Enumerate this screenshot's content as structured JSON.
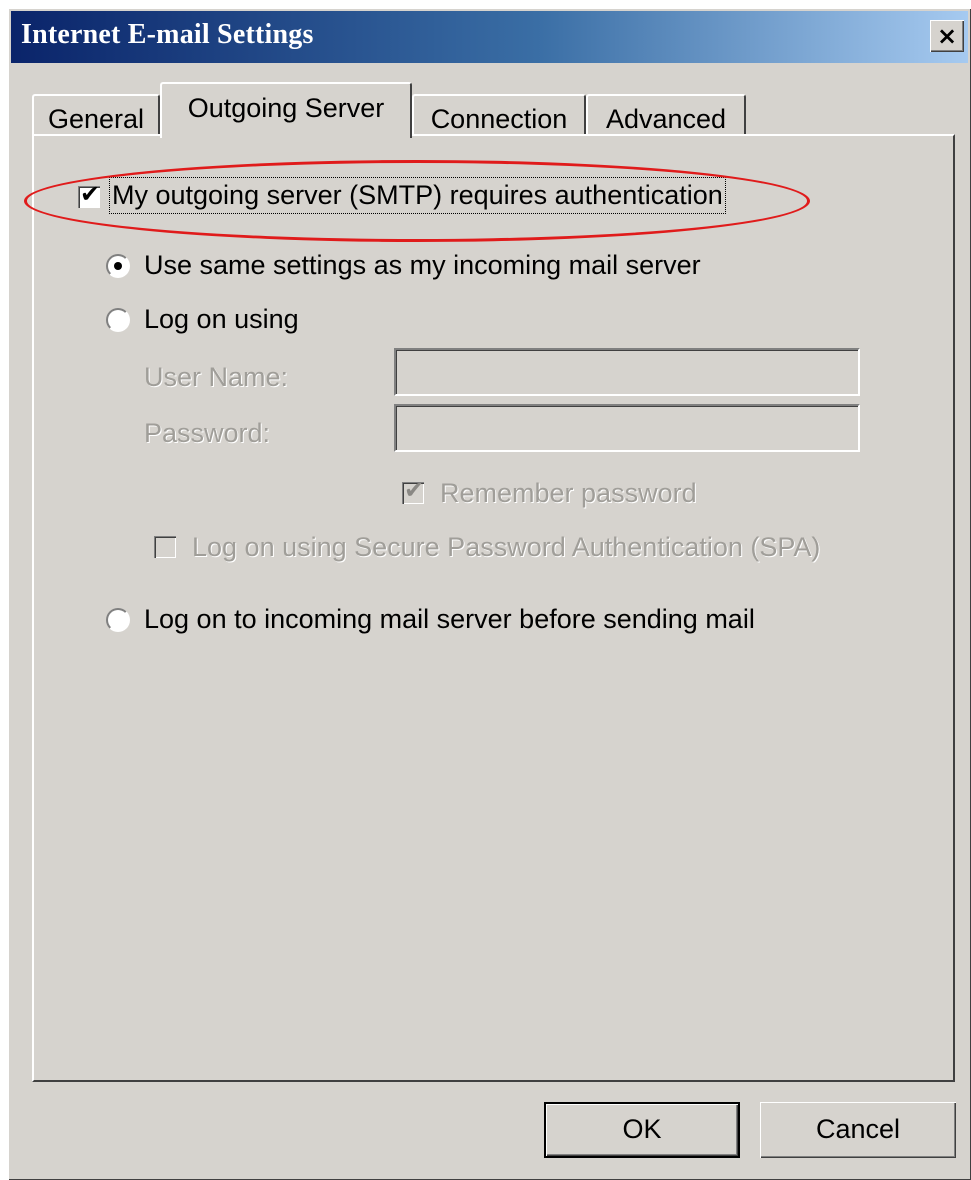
{
  "window": {
    "title": "Internet E-mail Settings",
    "close_glyph": "×"
  },
  "tabs": [
    {
      "label": "General",
      "active": false
    },
    {
      "label": "Outgoing Server",
      "active": true
    },
    {
      "label": "Connection",
      "active": false
    },
    {
      "label": "Advanced",
      "active": false
    }
  ],
  "outgoing": {
    "smtp_auth_label": "My outgoing server (SMTP) requires authentication",
    "smtp_auth_checked": true,
    "use_same_label": "Use same settings as my incoming mail server",
    "use_same_selected": true,
    "log_on_using_label": "Log on using",
    "log_on_using_selected": false,
    "user_name_label": "User Name:",
    "user_name_value": "",
    "password_label": "Password:",
    "password_value": "",
    "remember_password_label": "Remember password",
    "remember_password_checked": true,
    "spa_label": "Log on using Secure Password Authentication (SPA)",
    "spa_checked": false,
    "log_on_incoming_label": "Log on to incoming mail server before sending mail",
    "log_on_incoming_selected": false
  },
  "buttons": {
    "ok_label": "OK",
    "cancel_label": "Cancel"
  },
  "colors": {
    "dialog_face": "#d6d3ce",
    "title_bar_start": "#0a246a",
    "highlight_ellipse": "#e01b1b"
  },
  "check_glyph": "✔"
}
